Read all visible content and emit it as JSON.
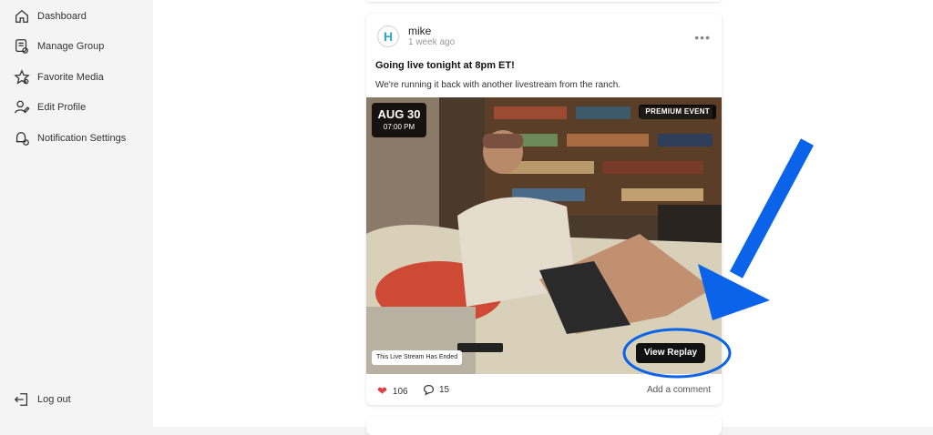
{
  "sidebar": {
    "items": [
      {
        "label": "Dashboard",
        "icon": "home-icon"
      },
      {
        "label": "Manage Group",
        "icon": "group-icon"
      },
      {
        "label": "Favorite Media",
        "icon": "star-icon"
      },
      {
        "label": "Edit Profile",
        "icon": "user-edit-icon"
      },
      {
        "label": "Notification Settings",
        "icon": "bell-settings-icon"
      }
    ],
    "logout_label": "Log out"
  },
  "post": {
    "author": "mike",
    "avatar_letter": "H",
    "time": "1 week ago",
    "more_icon": "•••",
    "title": "Going live tonight at 8pm ET!",
    "body": "We're running it back with another livestream from the ranch.",
    "media": {
      "date": "AUG 30",
      "time": "07:00 PM",
      "premium_label": "PREMIUM EVENT",
      "ended_label": "This Live Stream Has Ended",
      "replay_label": "View Replay"
    },
    "likes": "106",
    "comments": "15",
    "add_comment_label": "Add a comment"
  },
  "colors": {
    "annotation_blue": "#0a63e8",
    "like_red": "#e0413e",
    "avatar_teal": "#2fa5c8"
  }
}
